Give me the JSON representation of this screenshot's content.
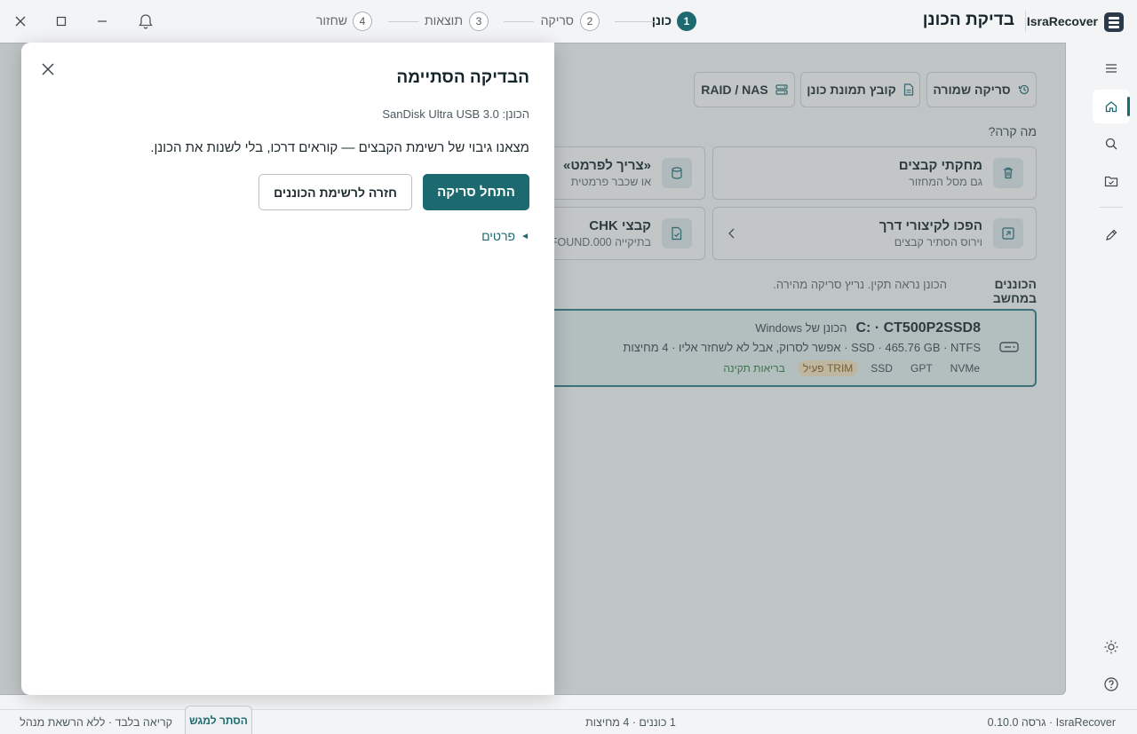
{
  "app": {
    "name": "IsraRecover",
    "page_title": "בדיקת הכונן"
  },
  "stepper": [
    {
      "num": "1",
      "label": "כונן",
      "active": true
    },
    {
      "num": "2",
      "label": "סריקה",
      "active": false
    },
    {
      "num": "3",
      "label": "תוצאות",
      "active": false
    },
    {
      "num": "4",
      "label": "שחזור",
      "active": false
    }
  ],
  "toolbar": {
    "saved_scan": "סריקה שמורה",
    "disk_image": "קובץ תמונת כונן",
    "raid_nas": "RAID / NAS"
  },
  "what_happened": {
    "label": "מה קרה?",
    "cards": [
      {
        "title": "מחקתי קבצים",
        "subtitle": "גם מסל המחזור",
        "icon": "trash-icon"
      },
      {
        "title": "«צריך לפרמט»",
        "subtitle": "או שכבר פרמטית",
        "icon": "disk-icon"
      },
      {
        "title": "הפכו לקיצורי דרך",
        "subtitle": "וירוס הסתיר קבצים",
        "icon": "shortcut-icon"
      },
      {
        "title": "קבצי CHK",
        "subtitle": "בתיקייה FOUND.000",
        "icon": "file-check-icon"
      }
    ]
  },
  "drives": {
    "label": "הכוננים במחשב",
    "hint": "הכונן נראה תקין. נריץ סריקה מהירה.",
    "items": [
      {
        "name": "C: · CT500P2SSD8",
        "os_note": "הכונן של Windows",
        "details": "SSD · 465.76 GB · NTFS · אפשר לסרוק, אבל לא לשחזר אליו · 4 מחיצות",
        "tags": {
          "nvme": "NVMe",
          "gpt": "GPT",
          "ssd": "SSD",
          "trim": "TRIM פעיל",
          "health": "בריאות תקינה"
        }
      }
    ]
  },
  "dialog": {
    "title": "הבדיקה הסתיימה",
    "device": "הכונן: SanDisk Ultra USB 3.0",
    "message": "מצאנו גיבוי של רשימת הקבצים — קוראים דרכו, בלי לשנות את הכונן.",
    "primary": "התחל סריקה",
    "secondary": "חזרה לרשימת הכוננים",
    "details": "פרטים",
    "details_arrow": "◄"
  },
  "statusbar": {
    "version": "IsraRecover · גרסה 0.10.0",
    "summary": "1 כוננים · 4 מחיצות",
    "mode": "קריאה בלבד · ללא הרשאת מנהל",
    "hide_tip": "הסתר למגש"
  },
  "colors": {
    "accent": "#1c6a70",
    "warn_bg": "#f6e2c2",
    "ok": "#2e7d3a"
  }
}
